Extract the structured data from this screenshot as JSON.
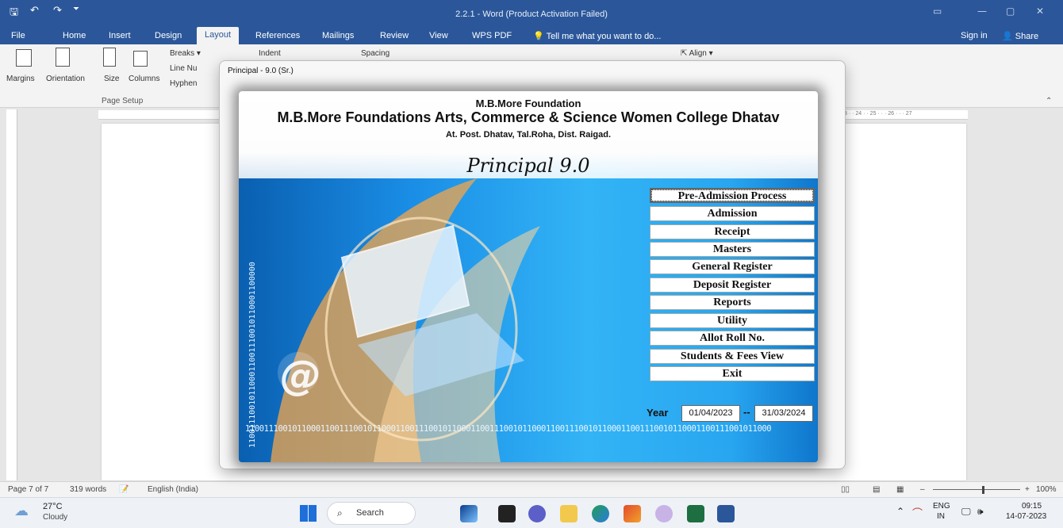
{
  "window": {
    "title": "2.2.1 - Word (Product Activation Failed)",
    "signin": "Sign in",
    "share": "Share"
  },
  "ribbon_tabs": [
    "File",
    "Home",
    "Insert",
    "Design",
    "Layout",
    "References",
    "Mailings",
    "Review",
    "View",
    "WPS PDF"
  ],
  "tell_me": "Tell me what you want to do...",
  "ribbon": {
    "margins": "Margins",
    "orientation": "Orientation",
    "size": "Size",
    "columns": "Columns",
    "breaks": "Breaks",
    "line_numbers": "Line Nu",
    "hyphenation": "Hyphen",
    "indent": "Indent",
    "spacing": "Spacing",
    "align": "Align",
    "group_page_setup": "Page Setup"
  },
  "ruler_text": "3 · · 24 · · 25 · · · 26 · · · 27",
  "status": {
    "page": "Page 7 of 7",
    "words": "319 words",
    "language": "English (India)",
    "zoom": "100%"
  },
  "taskbar": {
    "weather_temp": "27°C",
    "weather_desc": "Cloudy",
    "search": "Search",
    "lang_line1": "ENG",
    "lang_line2": "IN",
    "time": "09:15",
    "date": "14-07-2023"
  },
  "dialog": {
    "title": "Principal - 9.0 (Sr.)",
    "foundation": "M.B.More Foundation",
    "college": "M.B.More Foundations Arts, Commerce & Science Women College Dhatav",
    "address": "At. Post. Dhatav, Tal.Roha, Dist. Raigad.",
    "brand": "Principal 9.0",
    "menu": [
      "Pre-Admission Process",
      "Admission",
      "Receipt",
      "Masters",
      "General Register",
      "Deposit Register",
      "Reports",
      "Utility",
      "Allot Roll No.",
      "Students & Fees View",
      "Exit"
    ],
    "year_label": "Year",
    "year_from": "01/04/2023",
    "year_sep": "--",
    "year_to": "31/03/2024",
    "binary_text": "1100111001011000110011100101100011001110010110001100111001011000110011100101100011001110010110001100111001011000",
    "binary_vertical": "110011100101100011001110010110001100000"
  },
  "colors": {
    "word_blue": "#2b579a",
    "splash_blue": "#28a6f0"
  }
}
